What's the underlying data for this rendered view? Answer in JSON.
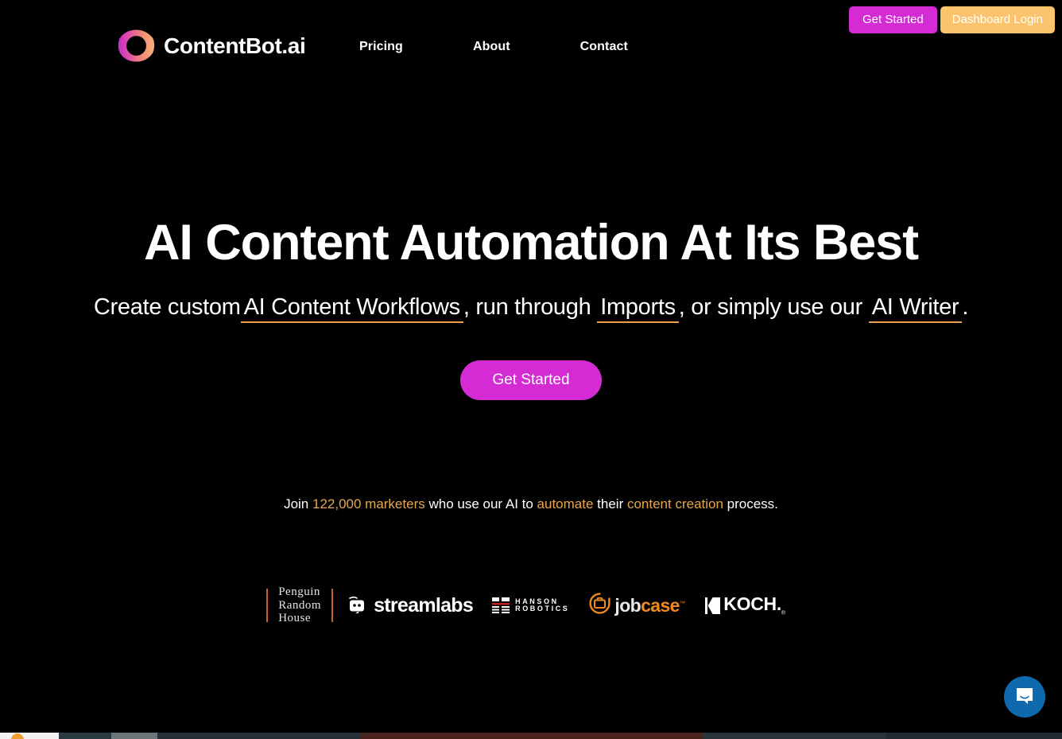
{
  "brand": {
    "name": "ContentBot.ai",
    "logo_icon": "contentbot-ring-logo",
    "gradient_start": "#c830c8",
    "gradient_end": "#f5a76b"
  },
  "nav": {
    "items": [
      {
        "label": "Pricing"
      },
      {
        "label": "About"
      },
      {
        "label": "Contact"
      }
    ]
  },
  "header_actions": {
    "get_started_label": "Get Started",
    "dashboard_login_label": "Dashboard Login",
    "get_started_color": "#d52bd4",
    "dashboard_login_color": "#fbc36c"
  },
  "hero": {
    "title": "AI Content Automation At Its Best",
    "subtitle": {
      "part1": "Create custom",
      "highlight1": "AI Content Workflows",
      "part2": ", run through ",
      "highlight2": "Imports",
      "part3": ", or simply use our ",
      "highlight3": "AI Writer",
      "part4": "."
    },
    "cta_label": "Get Started",
    "cta_color": "#d52bd4",
    "underline_color": "#e7a24a"
  },
  "social_proof": {
    "part1": "Join ",
    "accent1": "122,000 marketers",
    "part2": " who use our AI to ",
    "accent2": "automate",
    "part3": " their ",
    "accent3": "content creation",
    "part4": " process.",
    "accent_color": "#e8a64e"
  },
  "logo_bar": {
    "logos": [
      {
        "name": "Penguin Random House",
        "line1": "Penguin",
        "line2": "Random",
        "line3": "House"
      },
      {
        "name": "Streamlabs",
        "text": "streamlabs"
      },
      {
        "name": "Hanson Robotics",
        "line1": "HANSON",
        "line2": "ROBOTICS"
      },
      {
        "name": "Jobcase",
        "text_a": "job",
        "text_b": "case",
        "tm": "™"
      },
      {
        "name": "Koch",
        "text": "KOCH.",
        "tm": "®"
      }
    ]
  },
  "chat_widget": {
    "icon": "message-bubble-icon",
    "color": "#0f6aad"
  }
}
